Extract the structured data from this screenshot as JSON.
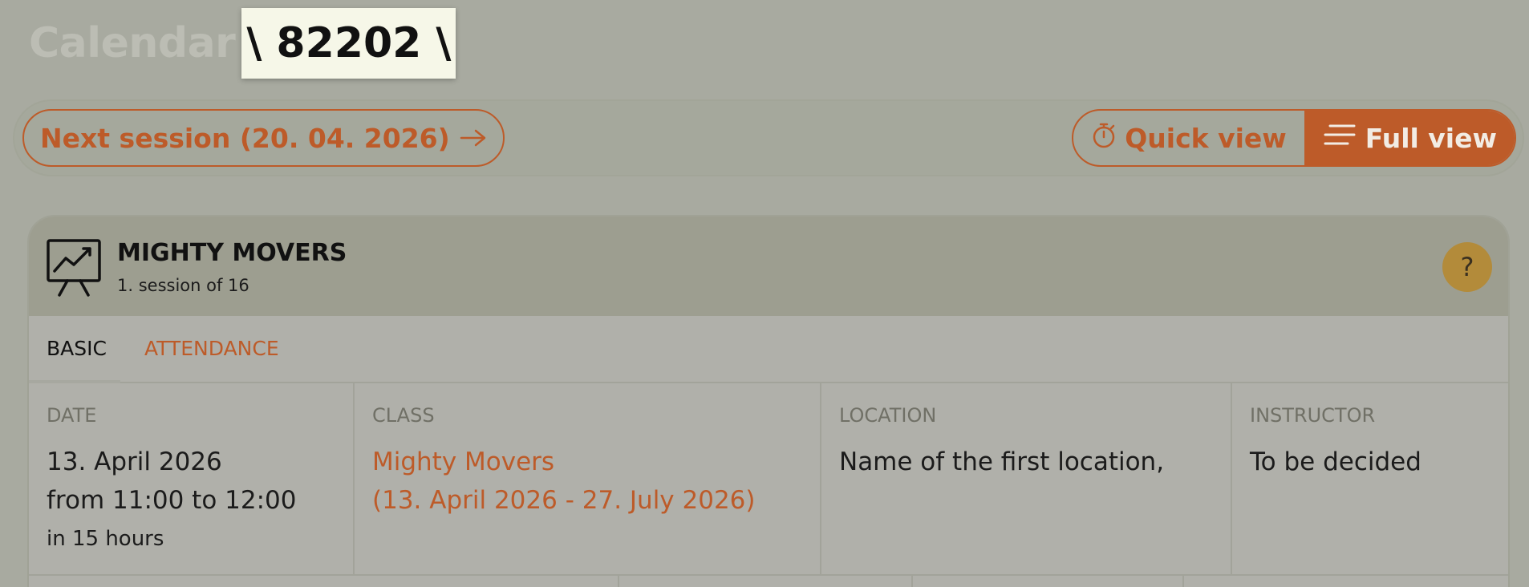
{
  "header": {
    "title": "Calendar",
    "record_id": "\\ 82202 \\"
  },
  "toolbar": {
    "next_session_label": "Next session (20. 04. 2026)",
    "quick_view_label": "Quick view",
    "full_view_label": "Full view"
  },
  "card": {
    "title": "MIGHTY MOVERS",
    "subtitle": "1. session of 16",
    "help_label": "?"
  },
  "tabs": [
    {
      "label": "BASIC"
    },
    {
      "label": "ATTENDANCE"
    }
  ],
  "details": {
    "date": {
      "label": "DATE",
      "line1": "13. April 2026",
      "line2": "from 11:00 to 12:00",
      "note": "in 15 hours"
    },
    "class": {
      "label": "CLASS",
      "line1": "Mighty Movers",
      "line2": "(13. April 2026 - 27. July 2026)"
    },
    "location": {
      "label": "LOCATION",
      "value": "Name of the first location,"
    },
    "instructor": {
      "label": "INSTRUCTOR",
      "value": "To be decided"
    }
  },
  "colors": {
    "accent": "#bd5b29",
    "background": "#a8aaa0",
    "help": "#b38b3a"
  }
}
